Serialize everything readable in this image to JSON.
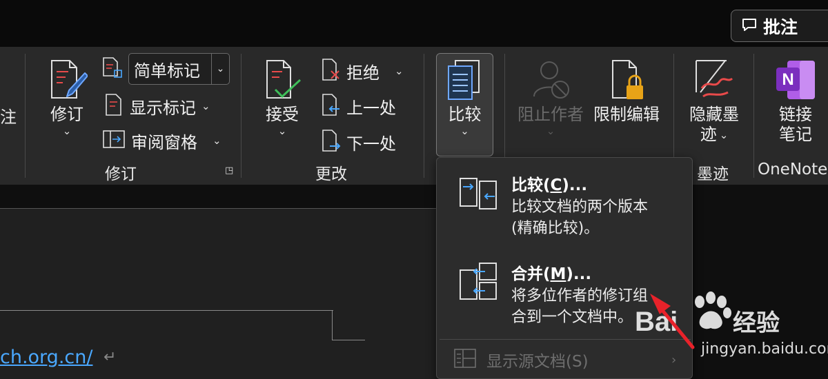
{
  "topbar": {
    "comment_label": "批注"
  },
  "ribbon": {
    "cut_off_label": "注",
    "track_changes": {
      "label": "修订",
      "group_label": "修订",
      "markup_dropdown_value": "简单标记",
      "show_markup": "显示标记",
      "review_pane": "审阅窗格"
    },
    "changes": {
      "accept": "接受",
      "reject": "拒绝",
      "previous": "上一处",
      "next": "下一处",
      "group_label": "更改"
    },
    "compare": {
      "label": "比较"
    },
    "protect": {
      "block_authors": "阻止作者",
      "restrict_editing": "限制编辑"
    },
    "ink": {
      "hide_ink_line1": "隐藏墨",
      "hide_ink_line2": "迹",
      "group_label": "墨迹"
    },
    "onenote": {
      "linked_notes_line1": "链接",
      "linked_notes_line2": "笔记",
      "group_label": "OneNote"
    }
  },
  "document": {
    "url_text": "ch.org.cn/"
  },
  "compare_menu": {
    "items": [
      {
        "title_pre": "比较(",
        "title_key": "C",
        "title_post": ")...",
        "desc_line1": "比较文档的两个版本",
        "desc_line2": "(精确比较)。"
      },
      {
        "title_pre": "合并(",
        "title_key": "M",
        "title_post": ")...",
        "desc_line1": "将多位作者的修订组",
        "desc_line2": "合到一个文档中。"
      }
    ],
    "show_source": "显示源文档(S)"
  },
  "watermark": {
    "text": "jingyan.baidu.com"
  },
  "colors": {
    "accent_blue": "#4aa8ff",
    "red_arrow": "#e8222a",
    "onenote_purple": "#7b2fbe",
    "lock_gold": "#e8a317"
  }
}
